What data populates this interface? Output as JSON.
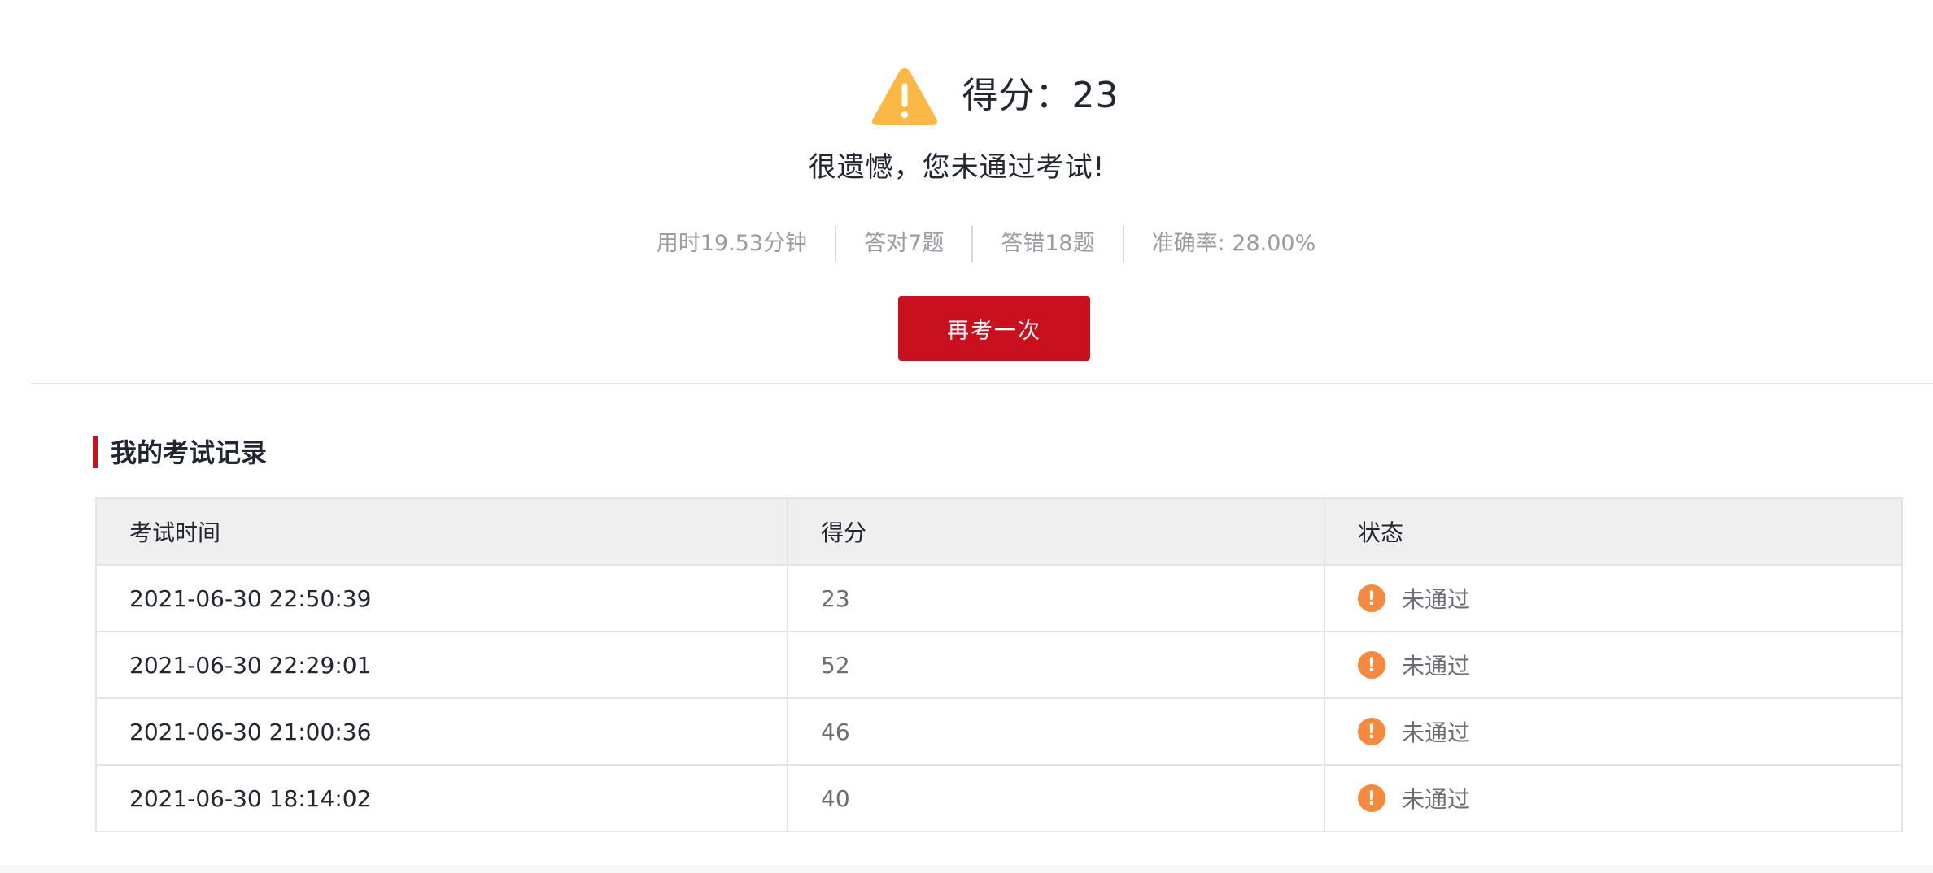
{
  "result": {
    "score_label": "得分：23",
    "message": "很遗憾，您未通过考试!",
    "stats": [
      "用时19.53分钟",
      "答对7题",
      "答错18题",
      "准确率: 28.00%"
    ],
    "retry_label": "再考一次"
  },
  "records": {
    "title": "我的考试记录",
    "columns": [
      "考试时间",
      "得分",
      "状态"
    ],
    "rows": [
      {
        "time": "2021-06-30 22:50:39",
        "score": "23",
        "status": "未通过"
      },
      {
        "time": "2021-06-30 22:29:01",
        "score": "52",
        "status": "未通过"
      },
      {
        "time": "2021-06-30 21:00:36",
        "score": "46",
        "status": "未通过"
      },
      {
        "time": "2021-06-30 18:14:02",
        "score": "40",
        "status": "未通过"
      }
    ]
  },
  "icons": {
    "header": "warning-triangle-icon",
    "status": "exclamation-circle-icon"
  },
  "colors": {
    "accent": "#c8101e",
    "warning": "#fbb844",
    "status_fail": "#f5893e"
  }
}
